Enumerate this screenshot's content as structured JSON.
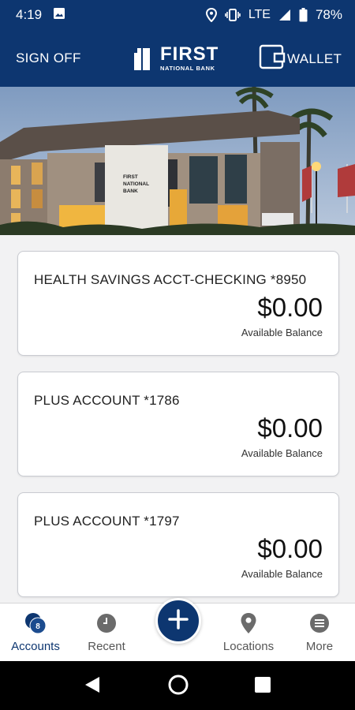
{
  "status_bar": {
    "time": "4:19",
    "network": "LTE",
    "battery": "78%",
    "icons": [
      "image-icon",
      "location-icon",
      "vibrate-icon",
      "signal-icon",
      "battery-icon"
    ]
  },
  "header": {
    "sign_off_label": "SIGN OFF",
    "logo_word": "FIRST",
    "logo_sub": "NATIONAL BANK",
    "wallet_label": "WALLET"
  },
  "accounts": [
    {
      "name": "HEALTH SAVINGS ACCT-CHECKING *8950",
      "balance": "$0.00",
      "balance_label": "Available Balance"
    },
    {
      "name": "PLUS ACCOUNT *1786",
      "balance": "$0.00",
      "balance_label": "Available Balance"
    },
    {
      "name": "PLUS ACCOUNT *1797",
      "balance": "$0.00",
      "balance_label": "Available Balance"
    }
  ],
  "bottom_nav": {
    "items": [
      {
        "label": "Accounts",
        "badge": "8",
        "icon": "accounts-icon"
      },
      {
        "label": "Recent",
        "icon": "clock-icon"
      },
      {
        "label": "Locations",
        "icon": "map-pin-icon"
      },
      {
        "label": "More",
        "icon": "menu-icon"
      }
    ],
    "fab_icon": "plus-icon"
  },
  "hero": {
    "building_sign": [
      "FIRST",
      "NATIONAL",
      "BANK"
    ]
  },
  "colors": {
    "brand_navy": "#0d3670",
    "background": "#f2f2f3",
    "card_border": "#c9cbd1",
    "nav_inactive": "#6b6b6b"
  }
}
